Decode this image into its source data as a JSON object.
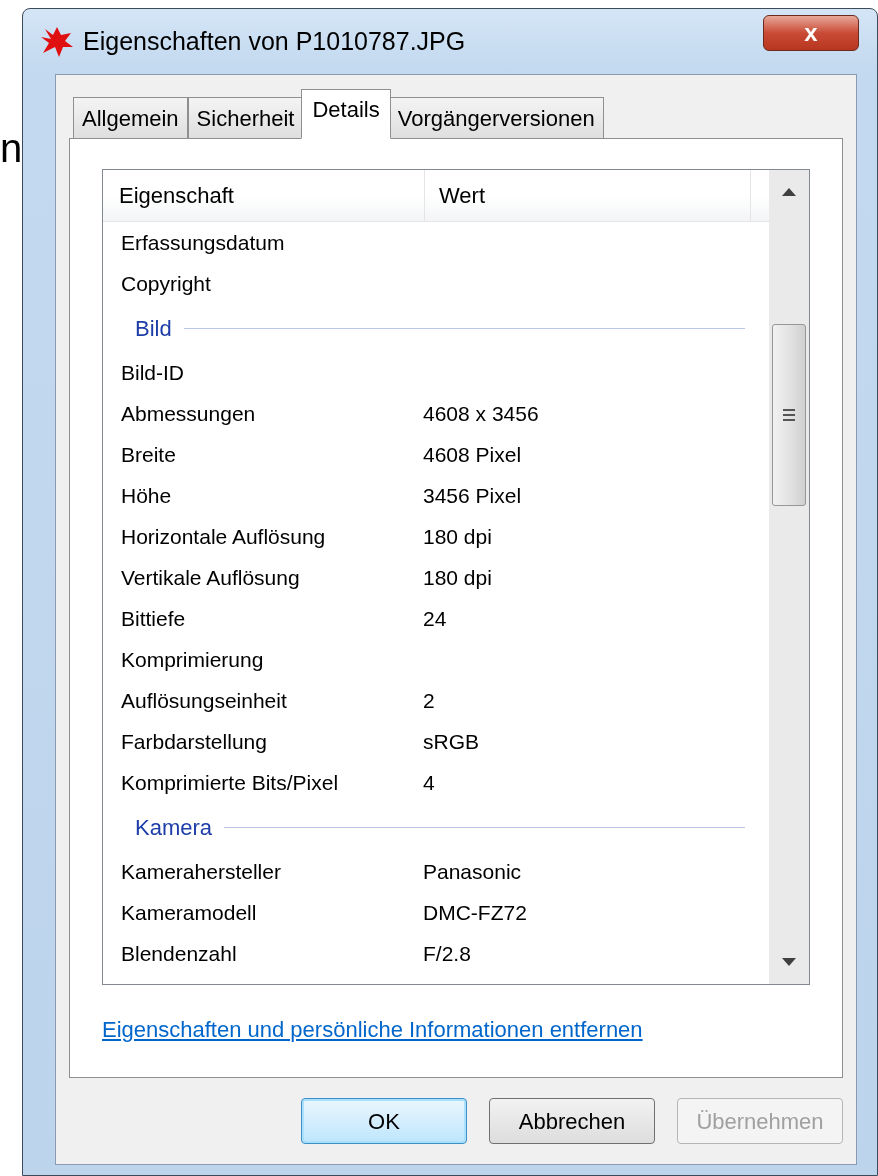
{
  "background_text": "n",
  "window": {
    "title": "Eigenschaften von P1010787.JPG",
    "close": "x"
  },
  "tabs": [
    {
      "label": "Allgemein",
      "selected": false
    },
    {
      "label": "Sicherheit",
      "selected": false
    },
    {
      "label": "Details",
      "selected": true
    },
    {
      "label": "Vorgängerversionen",
      "selected": false
    }
  ],
  "table": {
    "columns": [
      "Eigenschaft",
      "Wert"
    ],
    "rows": [
      {
        "kind": "property",
        "name": "Erfassungsdatum"
      },
      {
        "kind": "property",
        "name": "Copyright"
      },
      {
        "kind": "group",
        "name": "Bild"
      },
      {
        "kind": "property",
        "name": "Bild-ID"
      },
      {
        "kind": "property",
        "name": "Abmessungen",
        "value": "4608 x 3456"
      },
      {
        "kind": "property",
        "name": "Breite",
        "value": "4608 Pixel"
      },
      {
        "kind": "property",
        "name": "Höhe",
        "value": "3456 Pixel"
      },
      {
        "kind": "property",
        "name": "Horizontale Auflösung",
        "value": "180 dpi"
      },
      {
        "kind": "property",
        "name": "Vertikale Auflösung",
        "value": "180 dpi"
      },
      {
        "kind": "property",
        "name": "Bittiefe",
        "value": "24"
      },
      {
        "kind": "property",
        "name": "Komprimierung"
      },
      {
        "kind": "property",
        "name": "Auflösungseinheit",
        "value": "2"
      },
      {
        "kind": "property",
        "name": "Farbdarstellung",
        "value": "sRGB"
      },
      {
        "kind": "property",
        "name": "Komprimierte Bits/Pixel",
        "value": "4"
      },
      {
        "kind": "group",
        "name": "Kamera"
      },
      {
        "kind": "property",
        "name": "Kamerahersteller",
        "value": "Panasonic"
      },
      {
        "kind": "property",
        "name": "Kameramodell",
        "value": "DMC-FZ72"
      },
      {
        "kind": "property",
        "name": "Blendenzahl",
        "value": "F/2.8"
      }
    ]
  },
  "link": "Eigenschaften und persönliche Informationen entfernen",
  "buttons": [
    {
      "label": "OK",
      "disabled": false,
      "default": true
    },
    {
      "label": "Abbrechen",
      "disabled": false,
      "default": false
    },
    {
      "label": "Übernehmen",
      "disabled": true,
      "default": false
    }
  ]
}
